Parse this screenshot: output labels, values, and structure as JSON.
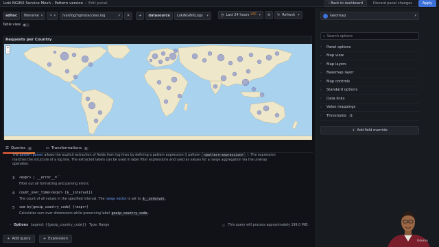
{
  "breadcrumb": {
    "dashboard": "Loki NGINX Service Mesh - Pattern version",
    "separator": "/",
    "page": "Edit panel"
  },
  "header_actions": {
    "back": "Back to dashboard",
    "discard": "Discard panel changes",
    "apply": "Apply"
  },
  "query_bar": {
    "label": "adhoc",
    "key": "filename",
    "operator": "=",
    "value": "/var/log/nginx/access.log",
    "datasource_label": "datasource",
    "datasource_value": "LokiNGINXLogs",
    "time_range": "Last 24 hours",
    "timezone": "UTC",
    "refresh": "Refresh"
  },
  "table_view": {
    "label": "Table view"
  },
  "panel": {
    "title": "Requests per Country"
  },
  "options_pane": {
    "visualization": "Geomap",
    "search_placeholder": "Search options",
    "items": [
      {
        "label": "Panel options"
      },
      {
        "label": "Map view"
      },
      {
        "label": "Map layers"
      },
      {
        "label": "Basemap layer"
      },
      {
        "label": "Map controls"
      },
      {
        "label": "Standard options"
      },
      {
        "label": "Data links"
      },
      {
        "label": "Value mappings"
      },
      {
        "label": "Thresholds",
        "badge": "2"
      }
    ],
    "add_override": "Add field override"
  },
  "tabs": [
    {
      "label": "Queries",
      "count": "4"
    },
    {
      "label": "Transformations",
      "count": "0"
    }
  ],
  "query_editor": {
    "pattern_line1_a": "The",
    "pattern_link": "pattern parser",
    "pattern_line1_b": "allows the explicit extraction of fields from log lines by defining a pattern expression (| pattern",
    "pattern_code": "`<pattern-expression>`",
    "pattern_line1_c": "). The expression",
    "pattern_line2": "matches the structure of a log line. The extracted labels can be used in label filter expressions and used as values for a range aggregation via the unwrap",
    "pattern_line3": "operation.",
    "steps": [
      {
        "num": "3",
        "head": "<expr> | __error__=``",
        "desc": "Filter out all formatting and parsing errors."
      },
      {
        "num": "4",
        "head": "count_over_time(<expr> [$__interval])",
        "desc_a": "The count of all values in the specified interval. The",
        "desc_link": "range vector",
        "desc_b": "is set to",
        "desc_code": "$__interval",
        "desc_c": "."
      },
      {
        "num": "5",
        "head": "sum by(geoip_country_code) (<expr>)",
        "desc_a": "Calculates sum over dimensions while preserving label",
        "desc_code": "geoip_country_code",
        "desc_c": "."
      }
    ],
    "options_label": "Options",
    "legend": "Legend: {{geoip_country_code}}",
    "type": "Type: Range",
    "processing_note": "This query will process approximately 199.0 MiB."
  },
  "bottom_buttons": {
    "add_query": "Add query",
    "expression": "Expression"
  },
  "watermark": "Udemy",
  "colors": {
    "background": "#111217",
    "panel": "#181b1f",
    "accent": "#3d71d9",
    "ocean": "#a9d2ee",
    "land": "#efe7c9",
    "bubble": "#8e98c9",
    "link": "#6e9fff",
    "active_tab": "#ff8833"
  }
}
